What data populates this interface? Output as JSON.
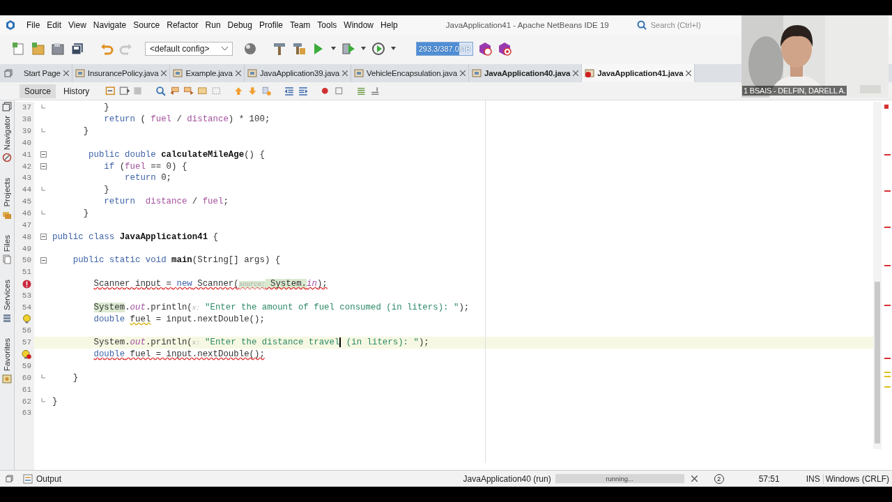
{
  "window": {
    "title": "JavaApplication41 - Apache NetBeans IDE 19"
  },
  "menu": [
    "File",
    "Edit",
    "View",
    "Navigate",
    "Source",
    "Refactor",
    "Run",
    "Debug",
    "Profile",
    "Team",
    "Tools",
    "Window",
    "Help"
  ],
  "search": {
    "placeholder": "Search (Ctrl+I)"
  },
  "toolbar": {
    "config": "<default config>",
    "memory": {
      "text": "293.3/387.0MB",
      "level": 0.76
    }
  },
  "tabs": [
    {
      "label": "Start Page",
      "kind": "page",
      "selected": false,
      "bold": false
    },
    {
      "label": "InsurancePolicy.java",
      "kind": "java",
      "selected": false,
      "bold": false
    },
    {
      "label": "Example.java",
      "kind": "java",
      "selected": false,
      "bold": false
    },
    {
      "label": "JavaApplication39.java",
      "kind": "java",
      "selected": false,
      "bold": false
    },
    {
      "label": "VehicleEncapsulation.java",
      "kind": "java",
      "selected": false,
      "bold": false
    },
    {
      "label": "JavaApplication40.java",
      "kind": "java",
      "selected": false,
      "bold": true
    },
    {
      "label": "JavaApplication41.java",
      "kind": "java-error",
      "selected": true,
      "bold": true
    }
  ],
  "editor_tabs": [
    {
      "label": "Source",
      "selected": true
    },
    {
      "label": "History",
      "selected": false
    }
  ],
  "side_tabs": [
    "Navigator",
    "Projects",
    "Files",
    "Services",
    "Favorites"
  ],
  "code": {
    "lines": [
      {
        "number": "37",
        "kind": "fold-end",
        "tokens": [
          {
            "text": "          }",
            "kind": "plain"
          }
        ]
      },
      {
        "number": "38",
        "kind": "plain",
        "tokens": [
          {
            "text": "          return",
            "kind": "kw"
          },
          {
            "text": " ( ",
            "kind": "plain"
          },
          {
            "text": "fuel",
            "kind": "field"
          },
          {
            "text": " / ",
            "kind": "plain"
          },
          {
            "text": "distance",
            "kind": "field"
          },
          {
            "text": ") * 100;",
            "kind": "plain"
          }
        ]
      },
      {
        "number": "39",
        "kind": "fold-end",
        "tokens": [
          {
            "text": "      }",
            "kind": "plain"
          }
        ]
      },
      {
        "number": "40",
        "kind": "plain"
      },
      {
        "number": "41",
        "kind": "fold-start",
        "tokens": [
          {
            "text": "       public double",
            "kind": "kw"
          },
          {
            "text": " calculateMileAge",
            "kind": "method"
          },
          {
            "text": "() {",
            "kind": "plain"
          }
        ]
      },
      {
        "number": "42",
        "kind": "fold-start",
        "tokens": [
          {
            "text": "          if",
            "kind": "kw"
          },
          {
            "text": " (",
            "kind": "plain"
          },
          {
            "text": "fuel",
            "kind": "field"
          },
          {
            "text": " == 0) {",
            "kind": "plain"
          }
        ]
      },
      {
        "number": "43",
        "kind": "plain",
        "tokens": [
          {
            "text": "              return",
            "kind": "kw"
          },
          {
            "text": " 0;",
            "kind": "plain"
          }
        ]
      },
      {
        "number": "44",
        "kind": "fold-end",
        "tokens": [
          {
            "text": "          }",
            "kind": "plain"
          }
        ]
      },
      {
        "number": "45",
        "kind": "plain",
        "tokens": [
          {
            "text": "          return",
            "kind": "kw"
          },
          {
            "text": "  distance",
            "kind": "field"
          },
          {
            "text": " / ",
            "kind": "plain"
          },
          {
            "text": "fuel",
            "kind": "field"
          },
          {
            "text": ";",
            "kind": "plain"
          }
        ]
      },
      {
        "number": "46",
        "kind": "fold-end",
        "tokens": [
          {
            "text": "      }",
            "kind": "plain"
          }
        ]
      },
      {
        "number": "47",
        "kind": "plain"
      },
      {
        "number": "48",
        "kind": "fold-start",
        "tokens": [
          {
            "text": "public class",
            "kind": "kw"
          },
          {
            "text": " JavaApplication41",
            "kind": "method"
          },
          {
            "text": " {",
            "kind": "plain"
          }
        ]
      },
      {
        "number": "49",
        "kind": "plain"
      },
      {
        "number": "50",
        "kind": "fold-start",
        "tokens": [
          {
            "text": "    public static void",
            "kind": "kw"
          },
          {
            "text": " main",
            "kind": "method"
          },
          {
            "text": "(String[] args) {",
            "kind": "plain"
          }
        ]
      },
      {
        "number": "51",
        "kind": "plain"
      },
      {
        "kind": "error",
        "tokens": [
          {
            "text": "        Scanner input = ",
            "kind": "plain",
            "error_underline": true
          },
          {
            "text": "new",
            "kind": "kw",
            "error_underline": true
          },
          {
            "text": " Scanner(",
            "kind": "plain",
            "error_underline": true
          },
          {
            "text": "source:",
            "kind": "hint",
            "error_underline": true,
            "highlight": true
          },
          {
            "text": " System.",
            "kind": "plain",
            "error_underline": true,
            "highlight": true
          },
          {
            "text": "in",
            "kind": "static",
            "error_underline": true
          },
          {
            "text": ");",
            "kind": "plain",
            "error_underline": true
          }
        ]
      },
      {
        "number": "53",
        "kind": "plain"
      },
      {
        "number": "54",
        "kind": "plain",
        "tokens": [
          {
            "text": "        System",
            "kind": "plain",
            "highlight": true
          },
          {
            "text": ".",
            "kind": "plain"
          },
          {
            "text": "out",
            "kind": "static"
          },
          {
            "text": ".println(",
            "kind": "plain"
          },
          {
            "text": "x:",
            "kind": "hint"
          },
          {
            "text": " \"Enter the amount of fuel consumed (in liters): \"",
            "kind": "str"
          },
          {
            "text": ");",
            "kind": "plain"
          }
        ]
      },
      {
        "kind": "warning",
        "tokens": [
          {
            "text": "        double ",
            "kind": "kw"
          },
          {
            "text": "fuel",
            "kind": "plain",
            "warning_underline": true
          },
          {
            "text": " = input.nextDouble();",
            "kind": "plain"
          }
        ]
      },
      {
        "number": "56",
        "kind": "plain"
      },
      {
        "number": "57",
        "kind": "plain",
        "current": true,
        "tokens": [
          {
            "text": "        System",
            "kind": "plain"
          },
          {
            "text": ".",
            "kind": "plain"
          },
          {
            "text": "out",
            "kind": "static"
          },
          {
            "text": ".println(",
            "kind": "plain"
          },
          {
            "text": "x:",
            "kind": "hint"
          },
          {
            "text": " \"Enter the distance travel",
            "kind": "str",
            "caret": true
          },
          {
            "text": " (in liters): \"",
            "kind": "str"
          },
          {
            "text": ");",
            "kind": "plain"
          }
        ]
      },
      {
        "kind": "warning-error",
        "tokens": [
          {
            "text": "        double",
            "kind": "kw",
            "error_underline": true
          },
          {
            "text": " fuel = input.nextDouble();",
            "kind": "plain",
            "error_underline": true
          }
        ]
      },
      {
        "number": "59",
        "kind": "plain"
      },
      {
        "number": "60",
        "kind": "fold-end",
        "tokens": [
          {
            "text": "    }",
            "kind": "plain"
          }
        ]
      },
      {
        "number": "61",
        "kind": "plain"
      },
      {
        "number": "62",
        "kind": "fold-end",
        "tokens": [
          {
            "text": "}",
            "kind": "plain"
          }
        ]
      },
      {
        "number": "63",
        "kind": "plain"
      }
    ]
  },
  "status_bar": {
    "output_tab": "Output",
    "task": "JavaApplication40 (run)",
    "progress": "running...",
    "notifications": "2",
    "position": "57:51",
    "mode": "INS",
    "line_endings": "Windows (CRLF)"
  },
  "webcam": {
    "kind": "picture",
    "name": "1 BSAIS - DELFIN, DARELL A."
  }
}
